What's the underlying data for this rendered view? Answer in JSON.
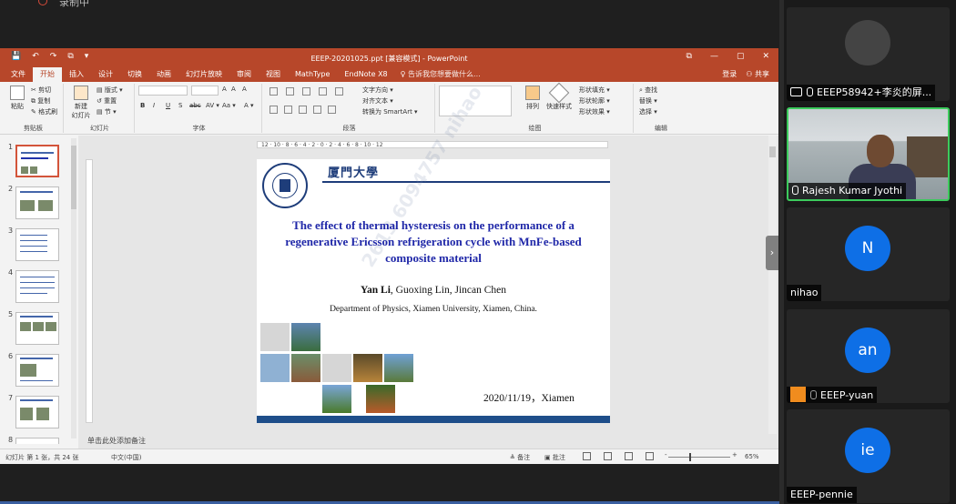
{
  "top": {
    "recording_text": "录制中"
  },
  "ppt": {
    "window_title": "EEEP-20201025.ppt [兼容模式] - PowerPoint",
    "quick_access": [
      "💾",
      "↶",
      "↷",
      "⧉",
      "▾"
    ],
    "window_controls": [
      "⧉",
      "—",
      "▢",
      "✕"
    ],
    "tabs": [
      "文件",
      "开始",
      "插入",
      "设计",
      "切换",
      "动画",
      "幻灯片放映",
      "审阅",
      "视图",
      "MathType",
      "EndNote X8"
    ],
    "active_tab": "开始",
    "tell_me": "♀ 告诉我您想要做什么...",
    "login": "登录",
    "share": "⚇ 共享",
    "ribbon": {
      "clipboard": {
        "label": "剪贴板",
        "paste": "粘贴",
        "cut": "✂ 剪切",
        "copy": "⧉ 复制",
        "format_painter": "✎ 格式刷"
      },
      "slides": {
        "label": "幻灯片",
        "new_slide": "新建\n幻灯片",
        "layout": "▤ 版式 ▾",
        "reset": "↺ 重置",
        "section": "▤ 节 ▾"
      },
      "font": {
        "label": "字体",
        "bold": "B",
        "italic": "I",
        "underline": "U",
        "shadow": "S",
        "strike": "abc",
        "spacing": "AV ▾",
        "case": "Aa ▾",
        "color": "A ▾",
        "grow": "A",
        "shrink": "A",
        "clear": "A"
      },
      "paragraph": {
        "label": "段落",
        "text_direction": "文字方向 ▾",
        "align_text": "对齐文本 ▾",
        "smartart": "转换为 SmartArt ▾"
      },
      "drawing": {
        "label": "绘图",
        "arrange": "排列",
        "quick_styles": "快速样式",
        "fill": "形状填充 ▾",
        "outline": "形状轮廓 ▾",
        "effects": "形状效果 ▾"
      },
      "editing": {
        "label": "编辑",
        "find": "⌕ 查找",
        "replace": "替换 ▾",
        "select": "选择 ▾"
      }
    },
    "ruler_text": "12 · 10 · 8 · 6 · 4 · 2 · 0 · 2 · 4 · 6 · 8 · 10 · 12",
    "thumbnail_numbers": [
      "1",
      "2",
      "3",
      "4",
      "5",
      "6",
      "7",
      "8"
    ],
    "slide": {
      "university": "厦門大學",
      "title": "The effect of thermal hysteresis on the performance of a regenerative Ericsson refrigeration cycle with MnFe-based composite material",
      "author_bold": "Yan Li",
      "authors_rest": ", Guoxing Lin, Jincan Chen",
      "affiliation": "Department of Physics, Xiamen University, Xiamen, China.",
      "date": "2020/11/19，Xiamen",
      "watermark": "2613 6094757 nihao"
    },
    "notes_placeholder": "单击此处添加备注",
    "status": {
      "slide_count": "幻灯片 第 1 张，共 24 张",
      "language": "中文(中国)",
      "notes": "≜ 备注",
      "comments": "▣ 批注",
      "zoom": "65%",
      "zoom_minus": "-",
      "zoom_plus": "+"
    }
  },
  "participants": [
    {
      "name": "EEEP58942+李炎的屏...",
      "type": "screenshare"
    },
    {
      "name": "Rajesh Kumar Jyothi",
      "type": "video"
    },
    {
      "name": "nihao",
      "initials": "N"
    },
    {
      "name": "EEEP-yuan",
      "initials": "an"
    },
    {
      "name": "EEEP-pennie",
      "initials": "ie"
    }
  ],
  "colors": {
    "ppt_accent": "#b7472a",
    "slide_title": "#1f27a8",
    "avatar": "#0e6fe6",
    "active_speaker": "#3ccb5c"
  }
}
